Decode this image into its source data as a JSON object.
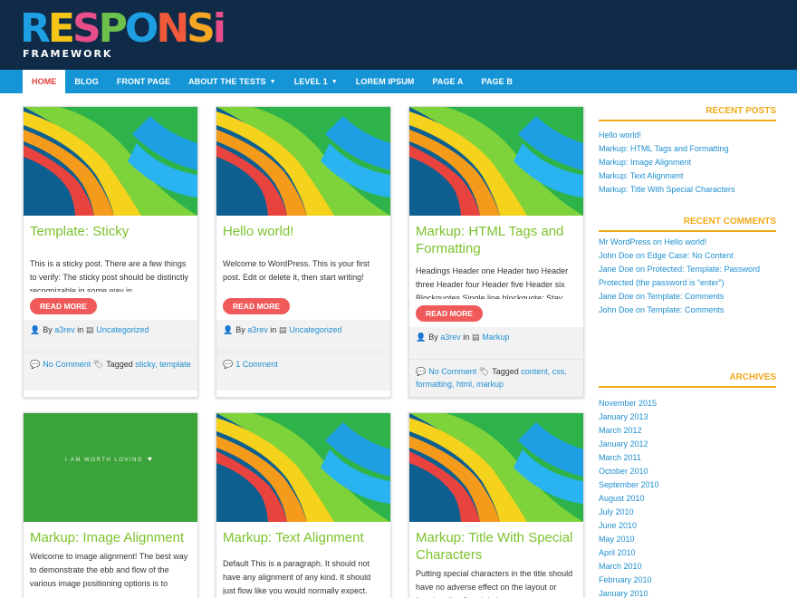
{
  "logo": {
    "letters": [
      "R",
      "E",
      "S",
      "P",
      "O",
      "N",
      "S",
      "i"
    ],
    "colors": [
      "#1e9ee3",
      "#f5c518",
      "#e84e8a",
      "#6dc04b",
      "#1e9ee3",
      "#f05a3a",
      "#f5a623",
      "#e84e8a"
    ],
    "tagline": "FRAMEWORK"
  },
  "nav": {
    "items": [
      {
        "label": "HOME",
        "active": true,
        "caret": false
      },
      {
        "label": "BLOG",
        "caret": false
      },
      {
        "label": "FRONT PAGE",
        "caret": false
      },
      {
        "label": "ABOUT THE TESTS",
        "caret": true
      },
      {
        "label": "LEVEL 1",
        "caret": true
      },
      {
        "label": "LOREM IPSUM",
        "caret": false
      },
      {
        "label": "PAGE A",
        "caret": false
      },
      {
        "label": "PAGE B",
        "caret": false
      }
    ]
  },
  "cards": [
    {
      "image": "ribbon",
      "title": "Template: Sticky",
      "excerpt": "This is a sticky post. There are a few things to verify: The sticky post should be distinctly recognizable in some way in",
      "read_more": "READ MORE",
      "by": "By",
      "author": "a3rev",
      "in": "in",
      "category": "Uncategorized",
      "comments": "No Comment",
      "tagged": "Tagged",
      "tags": "sticky, template"
    },
    {
      "image": "ribbon",
      "title": "Hello world!",
      "excerpt": "Welcome to WordPress. This is your first post. Edit or delete it, then start writing!",
      "read_more": "READ MORE",
      "by": "By",
      "author": "a3rev",
      "in": "in",
      "category": "Uncategorized",
      "comments": "1 Comment",
      "tagged": "",
      "tags": ""
    },
    {
      "image": "ribbon",
      "title": "Markup: HTML Tags and Formatting",
      "excerpt": "Headings Header one Header two Header three Header four Header five Header six Blockquotes Single line blockquote: Stay",
      "read_more": "READ MORE",
      "by": "By",
      "author": "a3rev",
      "in": "in",
      "category": "Markup",
      "comments": "No Comment",
      "tagged": "Tagged",
      "tags": "content, css, formatting, html, markup"
    },
    {
      "image": "green",
      "image_text": "I AM WORTH LOVING",
      "title": "Markup: Image Alignment",
      "excerpt": "Welcome to image alignment! The best way to demonstrate the ebb and flow of the various image positioning options is to"
    },
    {
      "image": "ribbon",
      "title": "Markup: Text Alignment",
      "excerpt": "Default This is a paragraph. It should not have any alignment of any kind. It should just flow like you would normally expect."
    },
    {
      "image": "ribbon",
      "title": "Markup: Title With Special Characters",
      "excerpt": "Putting special characters in the title should have no adverse effect on the layout or functionality. Special characters"
    }
  ],
  "sidebar": {
    "recent_posts": {
      "title": "RECENT POSTS",
      "items": [
        "Hello world!",
        "Markup: HTML Tags and Formatting",
        "Markup: Image Alignment",
        "Markup: Text Alignment",
        "Markup: Title With Special Characters"
      ]
    },
    "recent_comments": {
      "title": "RECENT COMMENTS",
      "items": [
        {
          "author": "Mr WordPress",
          "on": "on",
          "post": "Hello world!"
        },
        {
          "author": "John Doe",
          "on": "on",
          "post": "Edge Case: No Content"
        },
        {
          "author": "Jane Doe",
          "on": "on",
          "post": "Protected: Template: Password Protected (the password is “enter”)"
        },
        {
          "author": "Jane Doe",
          "on": "on",
          "post": "Template: Comments"
        },
        {
          "author": "John Doe",
          "on": "on",
          "post": "Template: Comments"
        }
      ]
    },
    "archives": {
      "title": "ARCHIVES",
      "items": [
        "November 2015",
        "January 2013",
        "March 2012",
        "January 2012",
        "March 2011",
        "October 2010",
        "September 2010",
        "August 2010",
        "July 2010",
        "June 2010",
        "May 2010",
        "April 2010",
        "March 2010",
        "February 2010",
        "January 2010"
      ]
    }
  }
}
